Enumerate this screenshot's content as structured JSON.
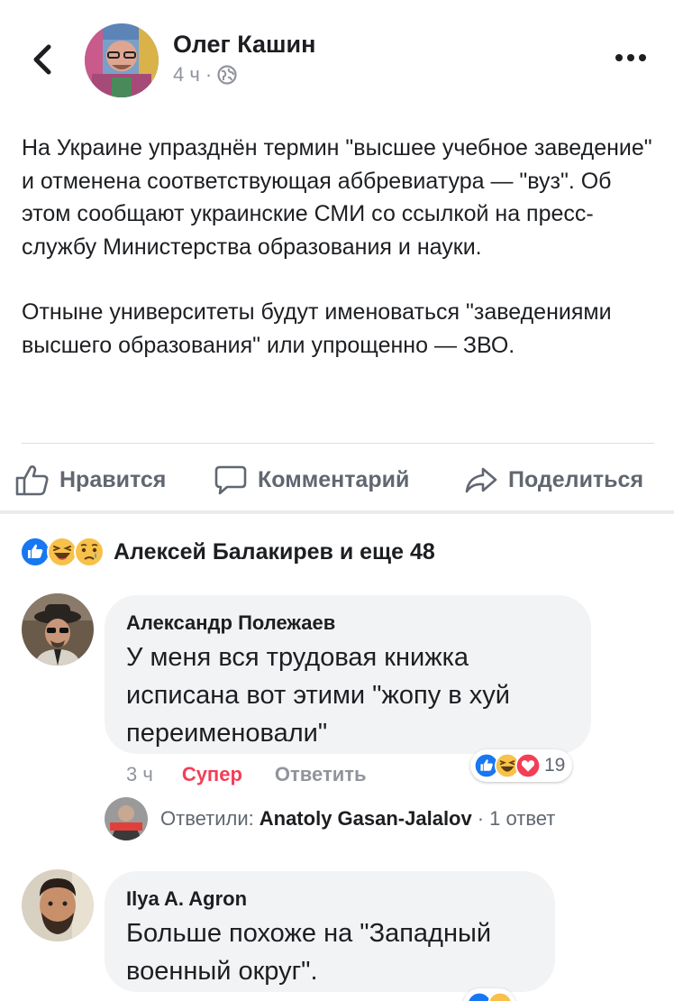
{
  "post": {
    "author": "Олег Кашин",
    "time": "4 ч",
    "meta_separator": "·",
    "paragraphs": [
      "На Украине упразднён термин \"высшее учебное заведение\" и отменена соответствующая аббревиатура — \"вуз\". Об этом сообщают украинские СМИ со ссылкой на пресс-службу Министерства образования и науки.",
      "Отныне университеты будут именоваться \"заведениями высшего образования\" или упрощенно — ЗВО."
    ]
  },
  "actions": {
    "like": "Нравится",
    "comment": "Комментарий",
    "share": "Поделиться"
  },
  "reactions": {
    "summary": "Алексей Балакирев и еще 48",
    "types": [
      "like",
      "haha",
      "sad"
    ]
  },
  "comments": [
    {
      "author": "Александр Полежаев",
      "text": "У меня вся трудовая книжка исписана вот этими \"жопу в хуй переименовали\"",
      "time": "3 ч",
      "reaction_label": "Супер",
      "reply_label": "Ответить",
      "reaction_types": [
        "like",
        "haha",
        "love"
      ],
      "reaction_count": "19",
      "replies_prefix": "Ответили:",
      "replies_author": "Anatoly Gasan-Jalalov",
      "replies_count": "· 1 ответ"
    },
    {
      "author": "Ilya A. Agron",
      "text": "Больше похоже на \"Западный военный округ\"."
    }
  ],
  "colors": {
    "accent_blue": "#1877f2",
    "love_red": "#f33e58",
    "muted": "#90949c",
    "bubble_bg": "#f2f3f5"
  },
  "icons": [
    "chevron-left-icon",
    "more-dots-icon",
    "globe-icon",
    "thumbs-up-icon",
    "comment-icon",
    "share-icon",
    "like-reaction-icon",
    "haha-reaction-icon",
    "sad-reaction-icon",
    "love-reaction-icon"
  ]
}
